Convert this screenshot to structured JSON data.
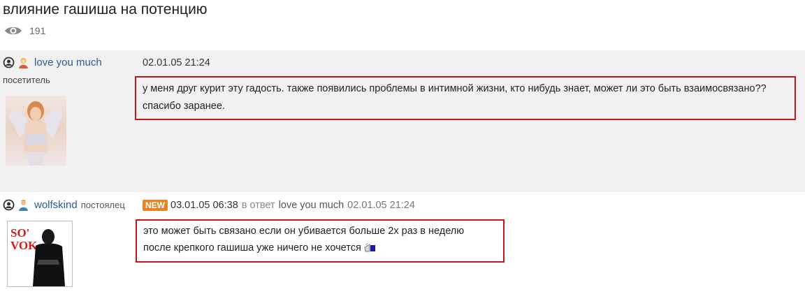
{
  "topic": {
    "title": "влияние гашиша на потенцию",
    "views_count": "191",
    "views_icon": "eye-icon"
  },
  "posts": [
    {
      "author": "love you much",
      "rank": "посетитель",
      "date": "02.01.05 21:24",
      "message_lines": [
        "у меня друг курит эту гадость. также появились проблемы в интимной жизни, кто нибудь знает, может ли это быть взаимосвязано??",
        "спасибо заранее."
      ]
    },
    {
      "author": "wolfskind",
      "rank": "постоялец",
      "badge": "NEW",
      "date": "03.01.05 06:38",
      "reply_prefix": "в ответ",
      "reply_to": "love you much",
      "reply_date": "02.01.05 21:24",
      "avatar_text_top": "SO'",
      "avatar_text_bottom": "VOK",
      "message_lines": [
        "это может быть связано если он убивается больше 2х раз в неделю",
        "после крепкого гашиша уже ничего не хочется"
      ]
    }
  ],
  "colors": {
    "highlight_border": "#c8161d",
    "username": "#2a5c9a",
    "new_badge": "#e3862a"
  }
}
